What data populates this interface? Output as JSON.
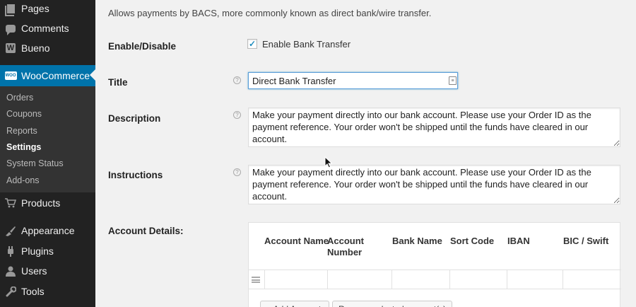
{
  "sidebar": {
    "menu": [
      {
        "label": "Pages",
        "icon": "pages-icon"
      },
      {
        "label": "Comments",
        "icon": "comments-icon"
      },
      {
        "label": "Bueno",
        "icon": "bueno-icon"
      },
      {
        "label": "WooCommerce",
        "icon": "woocommerce-icon"
      },
      {
        "label": "Products",
        "icon": "products-icon"
      },
      {
        "label": "Appearance",
        "icon": "appearance-icon"
      },
      {
        "label": "Plugins",
        "icon": "plugins-icon"
      },
      {
        "label": "Users",
        "icon": "users-icon"
      },
      {
        "label": "Tools",
        "icon": "tools-icon"
      }
    ],
    "woo_badge": "WOO",
    "submenu": [
      "Orders",
      "Coupons",
      "Reports",
      "Settings",
      "System Status",
      "Add-ons"
    ],
    "current_submenu": "Settings",
    "active_color": "#0073aa"
  },
  "form": {
    "intro": "Allows payments by BACS, more commonly known as direct bank/wire transfer.",
    "enable_label": "Enable/Disable",
    "enable_checkbox_label": "Enable Bank Transfer",
    "enable_checked": true,
    "title_label": "Title",
    "title_value": "Direct Bank Transfer",
    "description_label": "Description",
    "description_value": "Make your payment directly into our bank account. Please use your Order ID as the payment reference. Your order won't be shipped until the funds have cleared in our account.",
    "instructions_label": "Instructions",
    "instructions_value": "Make your payment directly into our bank account. Please use your Order ID as the payment reference. Your order won't be shipped until the funds have cleared in our account.",
    "account_details_label": "Account Details:",
    "help_glyph": "?"
  },
  "account_table": {
    "columns": [
      "Account Name",
      "Account Number",
      "Bank Name",
      "Sort Code",
      "IBAN",
      "BIC / Swift"
    ],
    "add_button": "+ Add Account",
    "remove_button": "Remove selected account(s)"
  }
}
